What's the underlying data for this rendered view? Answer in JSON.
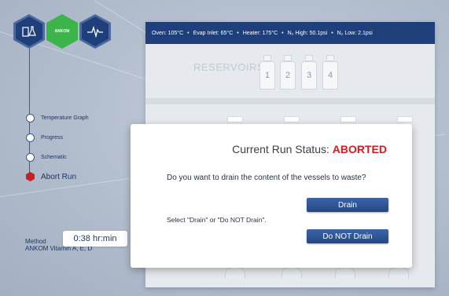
{
  "status_bar": {
    "oven": "Oven: 105°C",
    "evap_inlet": "Evap Inlet: 65°C",
    "heater": "Heater: 175°C",
    "n2_high": "N₂ High: 50.1psi",
    "n2_low": "N₂ Low: 2.1psi",
    "separator": "•"
  },
  "logo": {
    "icons": [
      "flask-icon",
      "ankom-logo",
      "waveform-icon"
    ],
    "ankom_text": "ANKOM"
  },
  "nav": {
    "items": [
      {
        "label": "Temperature Graph"
      },
      {
        "label": "Progress"
      },
      {
        "label": "Schematic"
      }
    ],
    "abort_label": "Abort Run"
  },
  "method": {
    "label": "Method",
    "name": "ANKOM Vitamin A, E, D"
  },
  "timer": "0:38 hr:min",
  "reservoirs": {
    "label": "RESERVOIRS",
    "numbers": [
      "1",
      "2",
      "3",
      "4"
    ]
  },
  "dialog": {
    "title_prefix": "Current Run Status: ",
    "status": "ABORTED",
    "question": "Do you want to drain the content of the vessels to waste?",
    "instruction": "Select \"Drain\" or \"Do NOT Drain\".",
    "drain_label": "Drain",
    "do_not_drain_label": "Do NOT Drain"
  },
  "colors": {
    "accent_blue": "#1f3f7a",
    "abort_red": "#c71f2a",
    "status_red": "#d21b22",
    "hex_green": "#3bb54a"
  }
}
